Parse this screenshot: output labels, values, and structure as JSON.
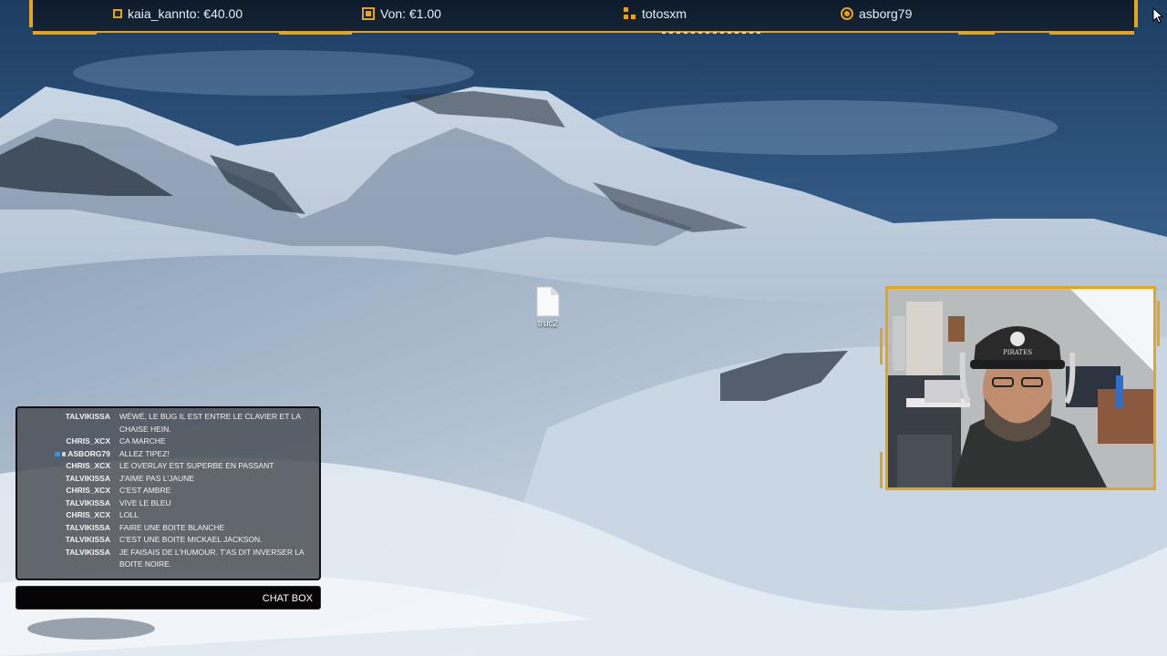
{
  "top_alerts": [
    {
      "icon": "square-icon",
      "text": "kaia_kannto: €40.00"
    },
    {
      "icon": "square-filled-icon",
      "text": "Von: €1.00"
    },
    {
      "icon": "steps-icon",
      "text": "totosxm"
    },
    {
      "icon": "circle-target-icon",
      "text": "asborg79"
    }
  ],
  "desktop": {
    "icon_label": "truc2"
  },
  "chat": {
    "messages": [
      {
        "user": "TALVIKISSA",
        "text": "WÉWÉ, LE BUG IL EST ENTRE LE CLAVIER ET LA CHAISE HEIN."
      },
      {
        "user": "CHRIS_XCX",
        "text": "CA MARCHE"
      },
      {
        "user": "ASBORG79",
        "text": "ALLEZ TIPEZ!"
      },
      {
        "user": "CHRIS_XCX",
        "text": "LE OVERLAY EST SUPERBE EN PASSANT"
      },
      {
        "user": "TALVIKISSA",
        "text": "J'AIME PAS L'JAUNE"
      },
      {
        "user": "CHRIS_XCX",
        "text": "C'EST AMBRE"
      },
      {
        "user": "TALVIKISSA",
        "text": "VIVE LE BLEU"
      },
      {
        "user": "CHRIS_XCX",
        "text": "LOLL"
      },
      {
        "user": "TALVIKISSA",
        "text": "FAIRE UNE BOITE BLANCHE"
      },
      {
        "user": "TALVIKISSA",
        "text": "C'EST UNE BOITE MICKAEL JACKSON."
      },
      {
        "user": "TALVIKISSA",
        "text": "JE FAISAIS DE L'HUMOUR. T'AS DIT INVERSER LA BOITE NOIRE."
      }
    ],
    "chatbox_label": "CHAT BOX"
  },
  "colors": {
    "accent": "#e8a317",
    "bar_bg": "#0d1a2b"
  }
}
